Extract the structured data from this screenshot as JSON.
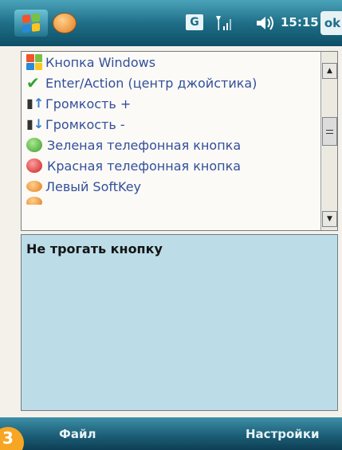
{
  "statusbar": {
    "g_label": "G",
    "signal_icon": "signal-icon",
    "volume_icon": "volume-icon",
    "time": "15:15",
    "ok_label": "ok"
  },
  "list": {
    "items": [
      {
        "label": "Кнопка Windows",
        "icon": "windows-flag-icon"
      },
      {
        "label": "Enter/Action (центр джойстика)",
        "icon": "check-icon"
      },
      {
        "label": "Громкость +",
        "icon": "volume-up-icon"
      },
      {
        "label": "Громкость -",
        "icon": "volume-down-icon"
      },
      {
        "label": "Зеленая телефонная кнопка",
        "icon": "green-phone-icon"
      },
      {
        "label": "Красная телефонная кнопка",
        "icon": "red-phone-icon"
      },
      {
        "label": "Левый SoftKey",
        "icon": "softkey-icon"
      }
    ]
  },
  "description": {
    "text": "Не трогать кнопку"
  },
  "softkeys": {
    "left": "Файл",
    "right": "Настройки"
  },
  "badge": {
    "text": "3"
  },
  "colors": {
    "title_bar": "#1f6f87",
    "list_text": "#334f9c",
    "description_bg": "#bcdde8"
  }
}
